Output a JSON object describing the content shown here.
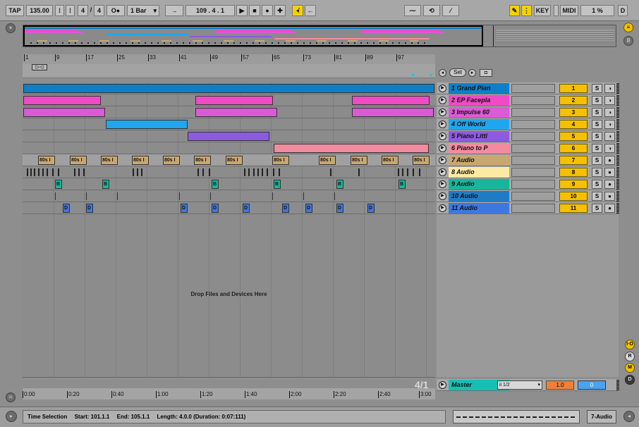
{
  "transport": {
    "tap": "TAP",
    "tempo": "135.00",
    "sig_num": "4",
    "sig_sep": "/",
    "sig_den": "4",
    "metronome": "O●",
    "quantize": "1 Bar",
    "follow": "→",
    "position": "109 .   4 .   1",
    "play": "▶",
    "stop": "■",
    "record": "●",
    "overdub": "✚",
    "loop_start_arrow": "←",
    "key": "KEY",
    "midi": "MIDI",
    "cpu": "1 %",
    "disk": "D"
  },
  "ruler": {
    "bars": [
      "1",
      "9",
      "17",
      "25",
      "33",
      "41",
      "49",
      "57",
      "65",
      "73",
      "81",
      "89",
      "97"
    ]
  },
  "set_controls": {
    "set_label": "Set"
  },
  "tracks": [
    {
      "name": "1 Grand Pian",
      "number": "1",
      "color": "#0e7fc6",
      "text_color": "#111"
    },
    {
      "name": "2 EP Facepla",
      "number": "2",
      "color": "#f04ac6",
      "text_color": "#111"
    },
    {
      "name": "3 Impulse 60",
      "number": "3",
      "color": "#db5ad6",
      "text_color": "#111"
    },
    {
      "name": "4 Off World",
      "number": "4",
      "color": "#1fa6ee",
      "text_color": "#111"
    },
    {
      "name": "5 Piano Littl",
      "number": "5",
      "color": "#8d5be0",
      "text_color": "#111"
    },
    {
      "name": "6 Piano to P",
      "number": "6",
      "color": "#f38ba0",
      "text_color": "#111"
    },
    {
      "name": "7 Audio",
      "number": "7",
      "color": "#c9a770",
      "text_color": "#111"
    },
    {
      "name": "8 Audio",
      "number": "8",
      "color": "#fbeaa4",
      "text_color": "#111"
    },
    {
      "name": "9 Audio",
      "number": "9",
      "color": "#18b59a",
      "text_color": "#111"
    },
    {
      "name": "10 Audio",
      "number": "10",
      "color": "#1e7cc5",
      "text_color": "#111"
    },
    {
      "name": "11 Audio",
      "number": "11",
      "color": "#3d78e0",
      "text_color": "#111"
    }
  ],
  "clip_labels": {
    "track7": "80s I",
    "track9": "B",
    "track11": "D"
  },
  "drop_text": "Drop Files and Devices Here",
  "time_signature_marker": "4/1",
  "time_ruler": [
    "0:00",
    "0:20",
    "0:40",
    "1:00",
    "1:20",
    "1:40",
    "2:00",
    "2:20",
    "2:40",
    "3:00"
  ],
  "master": {
    "name": "Master",
    "output": "ii 1/2",
    "volume": "1.0",
    "pan": "0",
    "color": "#16bfb3"
  },
  "status": {
    "title": "Time Selection",
    "start": "Start: 101.1.1",
    "end": "End: 105.1.1",
    "length": "Length: 4.0.0 (Duration: 0:07:111)",
    "selected": "7-Audio"
  },
  "side_buttons": [
    "I·O",
    "R",
    "M",
    "D"
  ]
}
